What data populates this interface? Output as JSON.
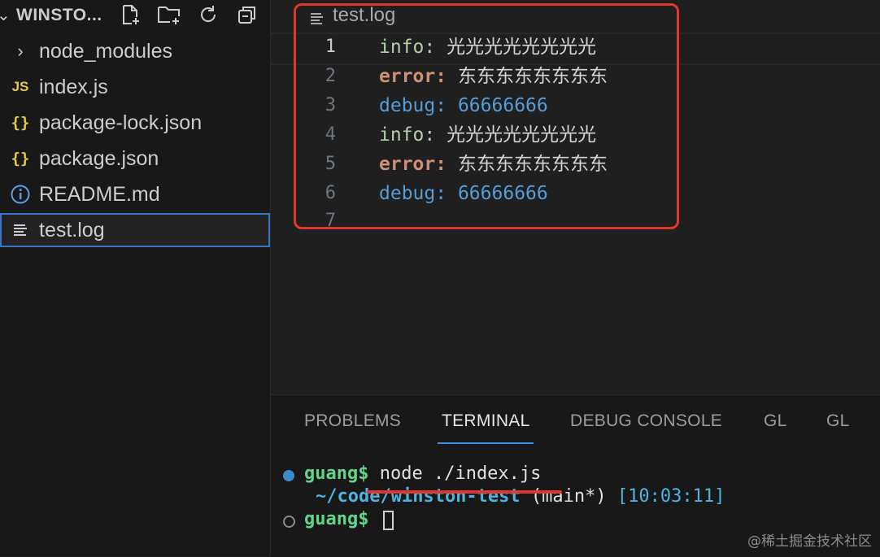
{
  "explorer": {
    "title": "WINSTO...",
    "actions": [
      "new-file-icon",
      "new-folder-icon",
      "refresh-icon",
      "collapse-all-icon"
    ],
    "items": [
      {
        "label": "node_modules",
        "icon": "chevron-right-icon",
        "type": "folder"
      },
      {
        "label": "index.js",
        "icon": "js-file-icon",
        "icon_text": "JS",
        "type": "file"
      },
      {
        "label": "package-lock.json",
        "icon": "json-file-icon",
        "icon_text": "{}",
        "type": "file"
      },
      {
        "label": "package.json",
        "icon": "json-file-icon",
        "icon_text": "{}",
        "type": "file"
      },
      {
        "label": "README.md",
        "icon": "info-icon",
        "type": "file"
      },
      {
        "label": "test.log",
        "icon": "log-file-icon",
        "type": "file",
        "selected": true
      }
    ]
  },
  "editor": {
    "breadcrumb": "test.log",
    "lines": [
      {
        "n": "1",
        "key": "info:",
        "value": "光光光光光光光光"
      },
      {
        "n": "2",
        "key": "error:",
        "value": "东东东东东东东东"
      },
      {
        "n": "3",
        "key": "debug:",
        "value": "66666666"
      },
      {
        "n": "4",
        "key": "info:",
        "value": "光光光光光光光光"
      },
      {
        "n": "5",
        "key": "error:",
        "value": "东东东东东东东东"
      },
      {
        "n": "6",
        "key": "debug:",
        "value": "66666666"
      },
      {
        "n": "7",
        "key": "",
        "value": ""
      }
    ]
  },
  "panel": {
    "tabs": [
      "PROBLEMS",
      "TERMINAL",
      "DEBUG CONSOLE",
      "GL",
      "GL"
    ],
    "active_tab": "TERMINAL",
    "terminal": {
      "prompt1_user": "guang$",
      "prompt1_cmd": "node ./index.js",
      "cwd": "~/code/winston-test",
      "branch": "(main*)",
      "time": "[10:03:11]",
      "prompt2_user": "guang$"
    }
  },
  "watermark": "@稀土掘金技术社区",
  "colors": {
    "highlight": "#e0382b",
    "accent": "#3a8de0"
  }
}
